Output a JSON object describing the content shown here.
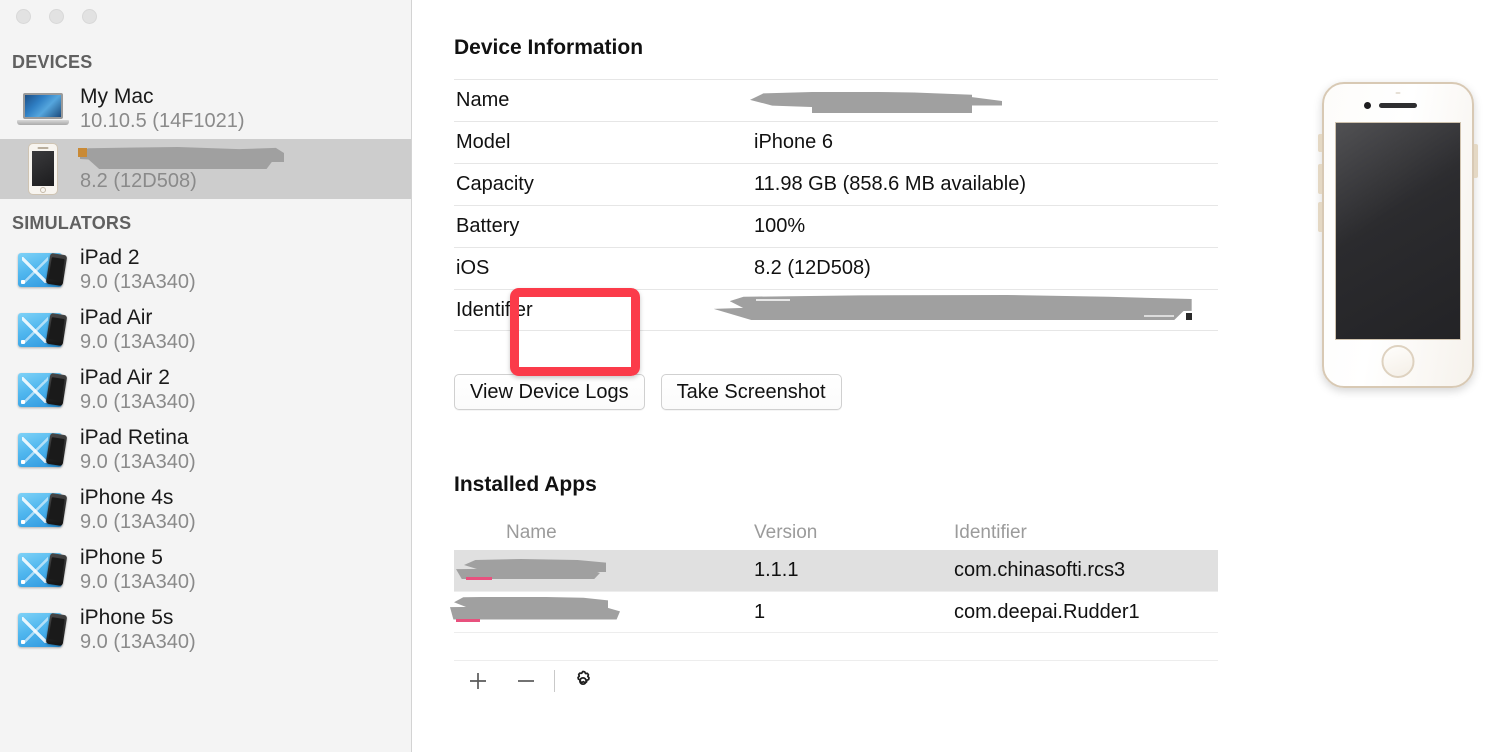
{
  "window": {
    "traffic_lights": [
      "close",
      "minimize",
      "zoom"
    ]
  },
  "sidebar": {
    "sections": [
      {
        "header": "DEVICES",
        "items": [
          {
            "icon": "macbook-icon",
            "title": "My Mac",
            "subtitle": "10.10.5 (14F1021)",
            "selected": false,
            "redacted_title": false
          },
          {
            "icon": "iphone-icon",
            "title": "",
            "subtitle": "8.2 (12D508)",
            "selected": true,
            "redacted_title": true
          }
        ]
      },
      {
        "header": "SIMULATORS",
        "items": [
          {
            "icon": "simulator-icon",
            "title": "iPad 2",
            "subtitle": "9.0 (13A340)",
            "selected": false,
            "redacted_title": false
          },
          {
            "icon": "simulator-icon",
            "title": "iPad Air",
            "subtitle": "9.0 (13A340)",
            "selected": false,
            "redacted_title": false
          },
          {
            "icon": "simulator-icon",
            "title": "iPad Air 2",
            "subtitle": "9.0 (13A340)",
            "selected": false,
            "redacted_title": false
          },
          {
            "icon": "simulator-icon",
            "title": "iPad Retina",
            "subtitle": "9.0 (13A340)",
            "selected": false,
            "redacted_title": false
          },
          {
            "icon": "simulator-icon",
            "title": "iPhone 4s",
            "subtitle": "9.0 (13A340)",
            "selected": false,
            "redacted_title": false
          },
          {
            "icon": "simulator-icon",
            "title": "iPhone 5",
            "subtitle": "9.0 (13A340)",
            "selected": false,
            "redacted_title": false
          },
          {
            "icon": "simulator-icon",
            "title": "iPhone 5s",
            "subtitle": "9.0 (13A340)",
            "selected": false,
            "redacted_title": false
          }
        ]
      }
    ]
  },
  "device_information": {
    "title": "Device Information",
    "rows": [
      {
        "label": "Name",
        "value": "",
        "redacted": true
      },
      {
        "label": "Model",
        "value": "iPhone 6",
        "redacted": false
      },
      {
        "label": "Capacity",
        "value": "11.98 GB (858.6 MB available)",
        "redacted": false
      },
      {
        "label": "Battery",
        "value": "100%",
        "redacted": false
      },
      {
        "label": "iOS",
        "value": "8.2 (12D508)",
        "redacted": false
      },
      {
        "label": "Identifier",
        "value": "",
        "redacted": true
      }
    ],
    "buttons": [
      {
        "label": "View Device Logs"
      },
      {
        "label": "Take Screenshot"
      }
    ]
  },
  "installed_apps": {
    "title": "Installed Apps",
    "columns": [
      "Name",
      "Version",
      "Identifier"
    ],
    "rows": [
      {
        "name": "",
        "name_redacted": true,
        "version": "1.1.1",
        "identifier": "com.chinasofti.rcs3",
        "selected": true
      },
      {
        "name": "",
        "name_redacted": true,
        "version": "1",
        "identifier": "com.deepai.Rudder1",
        "selected": false
      }
    ],
    "toolbar": {
      "add_label": "+",
      "remove_label": "−",
      "settings_icon": "gear-icon"
    }
  },
  "device_photo": {
    "model": "iPhone 6",
    "finish": "gold-white"
  },
  "annotation": {
    "type": "rectangle-highlight",
    "color": "#fb3b4a",
    "target": "gear-icon"
  }
}
